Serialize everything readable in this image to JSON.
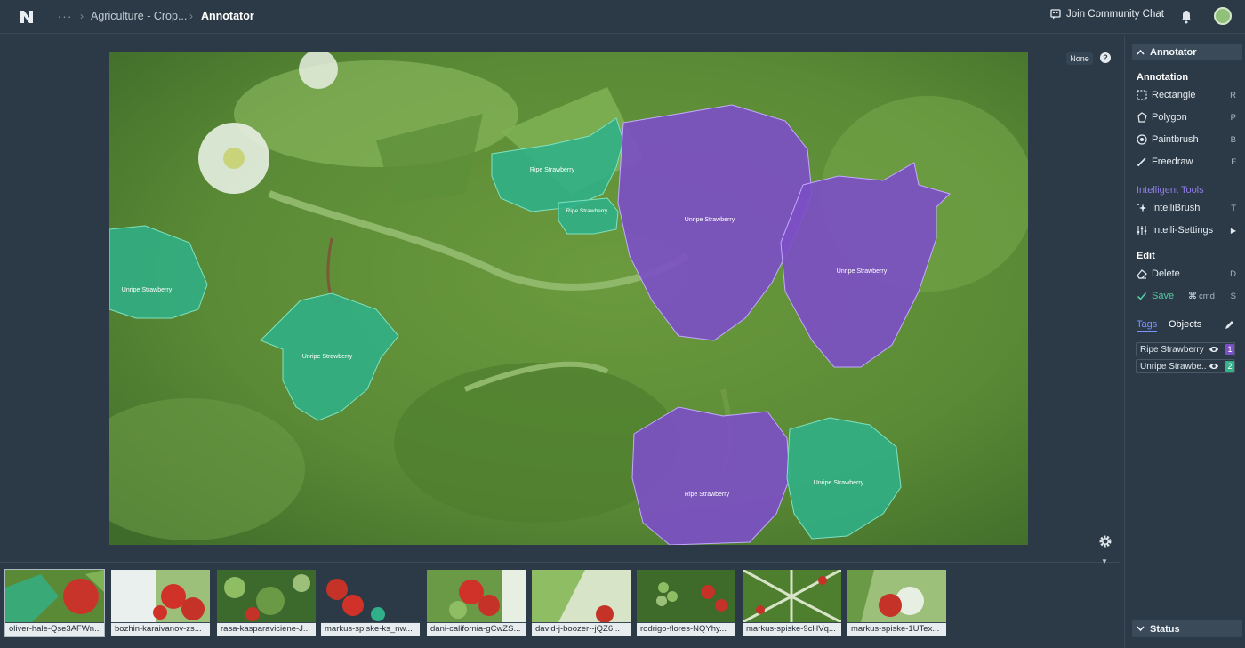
{
  "header": {
    "project_crumb": "Agriculture - Crop...",
    "current_crumb": "Annotator",
    "community_label": "Join Community Chat"
  },
  "canvas": {
    "view_filter": "None",
    "help_glyph": "?",
    "annotations": [
      {
        "label": "Unripe Strawberry",
        "tag": "unripe"
      },
      {
        "label": "Unripe Strawberry",
        "tag": "unripe"
      },
      {
        "label": "Ripe Strawberry",
        "tag": "ripe"
      },
      {
        "label": "Ripe Strawberry",
        "tag": "ripe"
      },
      {
        "label": "Unripe Strawberry",
        "tag": "unripe"
      },
      {
        "label": "Unripe Strawberry",
        "tag": "unripe"
      },
      {
        "label": "Ripe Strawberry",
        "tag": "ripe"
      },
      {
        "label": "Unripe Strawberry",
        "tag": "unripe"
      }
    ]
  },
  "sidebar": {
    "annotator_header": "Annotator",
    "annotation_title": "Annotation",
    "tools": [
      {
        "label": "Rectangle",
        "key": "R",
        "icon": "rectangle-icon"
      },
      {
        "label": "Polygon",
        "key": "P",
        "icon": "polygon-icon"
      },
      {
        "label": "Paintbrush",
        "key": "B",
        "icon": "paintbrush-icon"
      },
      {
        "label": "Freedraw",
        "key": "F",
        "icon": "freedraw-icon"
      }
    ],
    "intelligent_title": "Intelligent Tools",
    "intelli_tools": [
      {
        "label": "IntelliBrush",
        "key": "T",
        "icon": "sparkle-icon"
      },
      {
        "label": "Intelli-Settings",
        "key": "",
        "icon": "sliders-icon"
      }
    ],
    "edit_title": "Edit",
    "edit_tools": [
      {
        "label": "Delete",
        "key": "D",
        "icon": "eraser-icon"
      },
      {
        "label": "Save",
        "key": "S",
        "modifier": "cmd",
        "icon": "check-icon"
      }
    ],
    "tabs": {
      "tags": "Tags",
      "objects": "Objects"
    },
    "tags": [
      {
        "label": "Ripe Strawberry",
        "count": "1",
        "color": "#7c4fc4"
      },
      {
        "label": "Unripe Strawbe...",
        "count": "2",
        "color": "#34b389"
      }
    ],
    "status_header": "Status"
  },
  "colors": {
    "ripe": "#7c4fc4",
    "unripe": "#2fb088",
    "accent": "#7b92ff",
    "background": "#2c3a47"
  },
  "filmstrip": [
    {
      "name": "oliver-hale-Qse3AFWn...",
      "active": true
    },
    {
      "name": "bozhin-karaivanov-zs...",
      "active": false
    },
    {
      "name": "rasa-kasparaviciene-J...",
      "active": false
    },
    {
      "name": "markus-spiske-ks_nw...",
      "active": false
    },
    {
      "name": "dani-california-gCwZS...",
      "active": false
    },
    {
      "name": "david-j-boozer--jQZ6...",
      "active": false
    },
    {
      "name": "rodrigo-flores-NQYhy...",
      "active": false
    },
    {
      "name": "markus-spiske-9cHVq...",
      "active": false
    },
    {
      "name": "markus-spiske-1UTex...",
      "active": false
    }
  ]
}
